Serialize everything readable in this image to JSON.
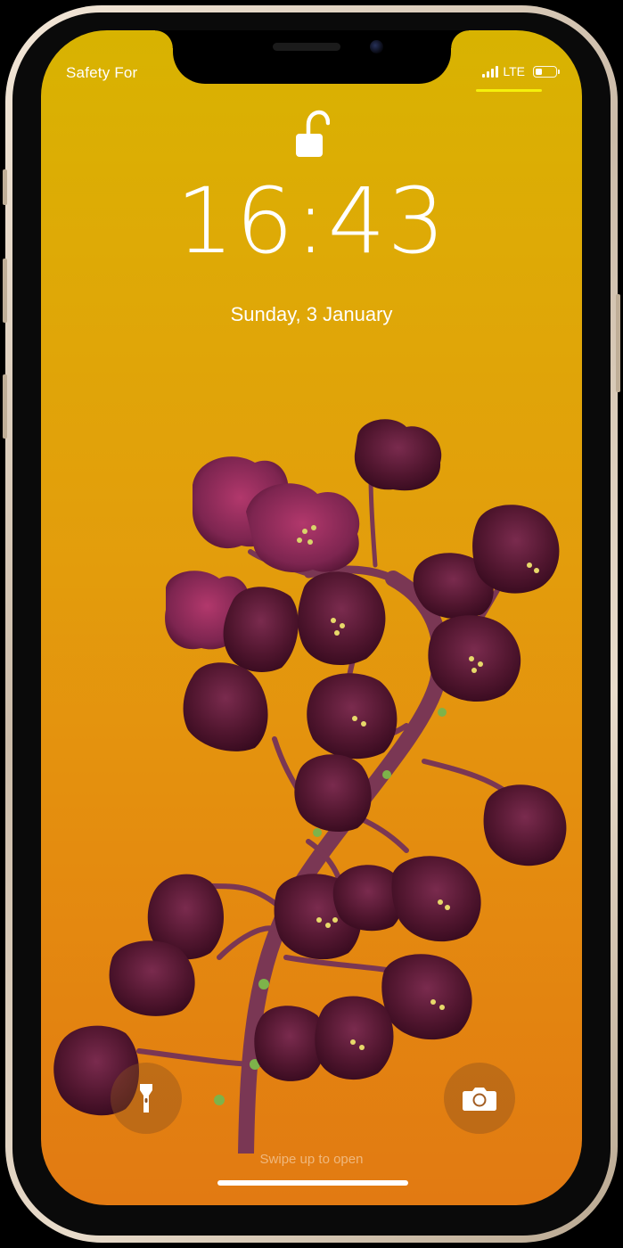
{
  "status_bar": {
    "carrier": "Safety For",
    "network": "LTE",
    "signal_bars": 4,
    "battery_level": 0.35
  },
  "lock_screen": {
    "time": "16:43",
    "date": "Sunday, 3 January",
    "swipe_hint": "Swipe up to open"
  },
  "icons": {
    "lock": "unlocked-padlock-icon",
    "flashlight": "flashlight-icon",
    "camera": "camera-icon"
  },
  "colors": {
    "wallpaper_top": "#d8b301",
    "wallpaper_bottom": "#e27a12",
    "status_accent": "#f5f10b",
    "flower": "#5a1a35"
  }
}
